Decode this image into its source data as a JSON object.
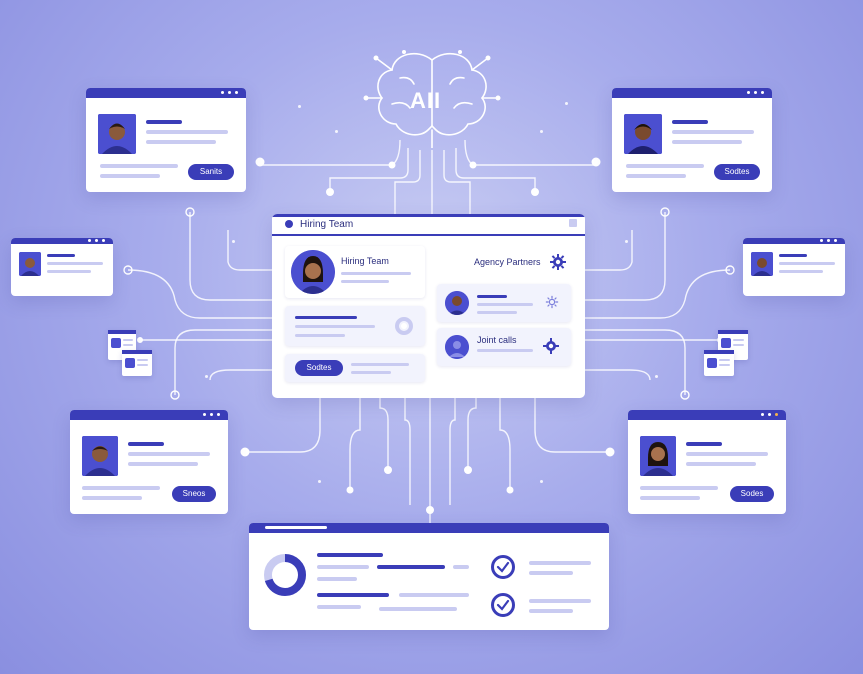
{
  "brain": {
    "label": "AII"
  },
  "hub": {
    "title": "Hiring Team",
    "profile_label": "Hiring Team",
    "agency_label": "Agency Partners",
    "sub_label": "Joint calls",
    "button": "Sodtes"
  },
  "cards": [
    {
      "id": "top-left",
      "button": "Sanits"
    },
    {
      "id": "top-right",
      "button": "Sodtes"
    },
    {
      "id": "mid-left",
      "button": "Sneos"
    },
    {
      "id": "mid-right",
      "button": "Sodes"
    }
  ],
  "colors": {
    "accent": "#3a3db8",
    "light_line": "#c9cbf1",
    "background": "#a7acec"
  },
  "icons": [
    "brain-icon",
    "gear-icon",
    "check-icon",
    "donut-chart-icon",
    "avatar-icon"
  ]
}
